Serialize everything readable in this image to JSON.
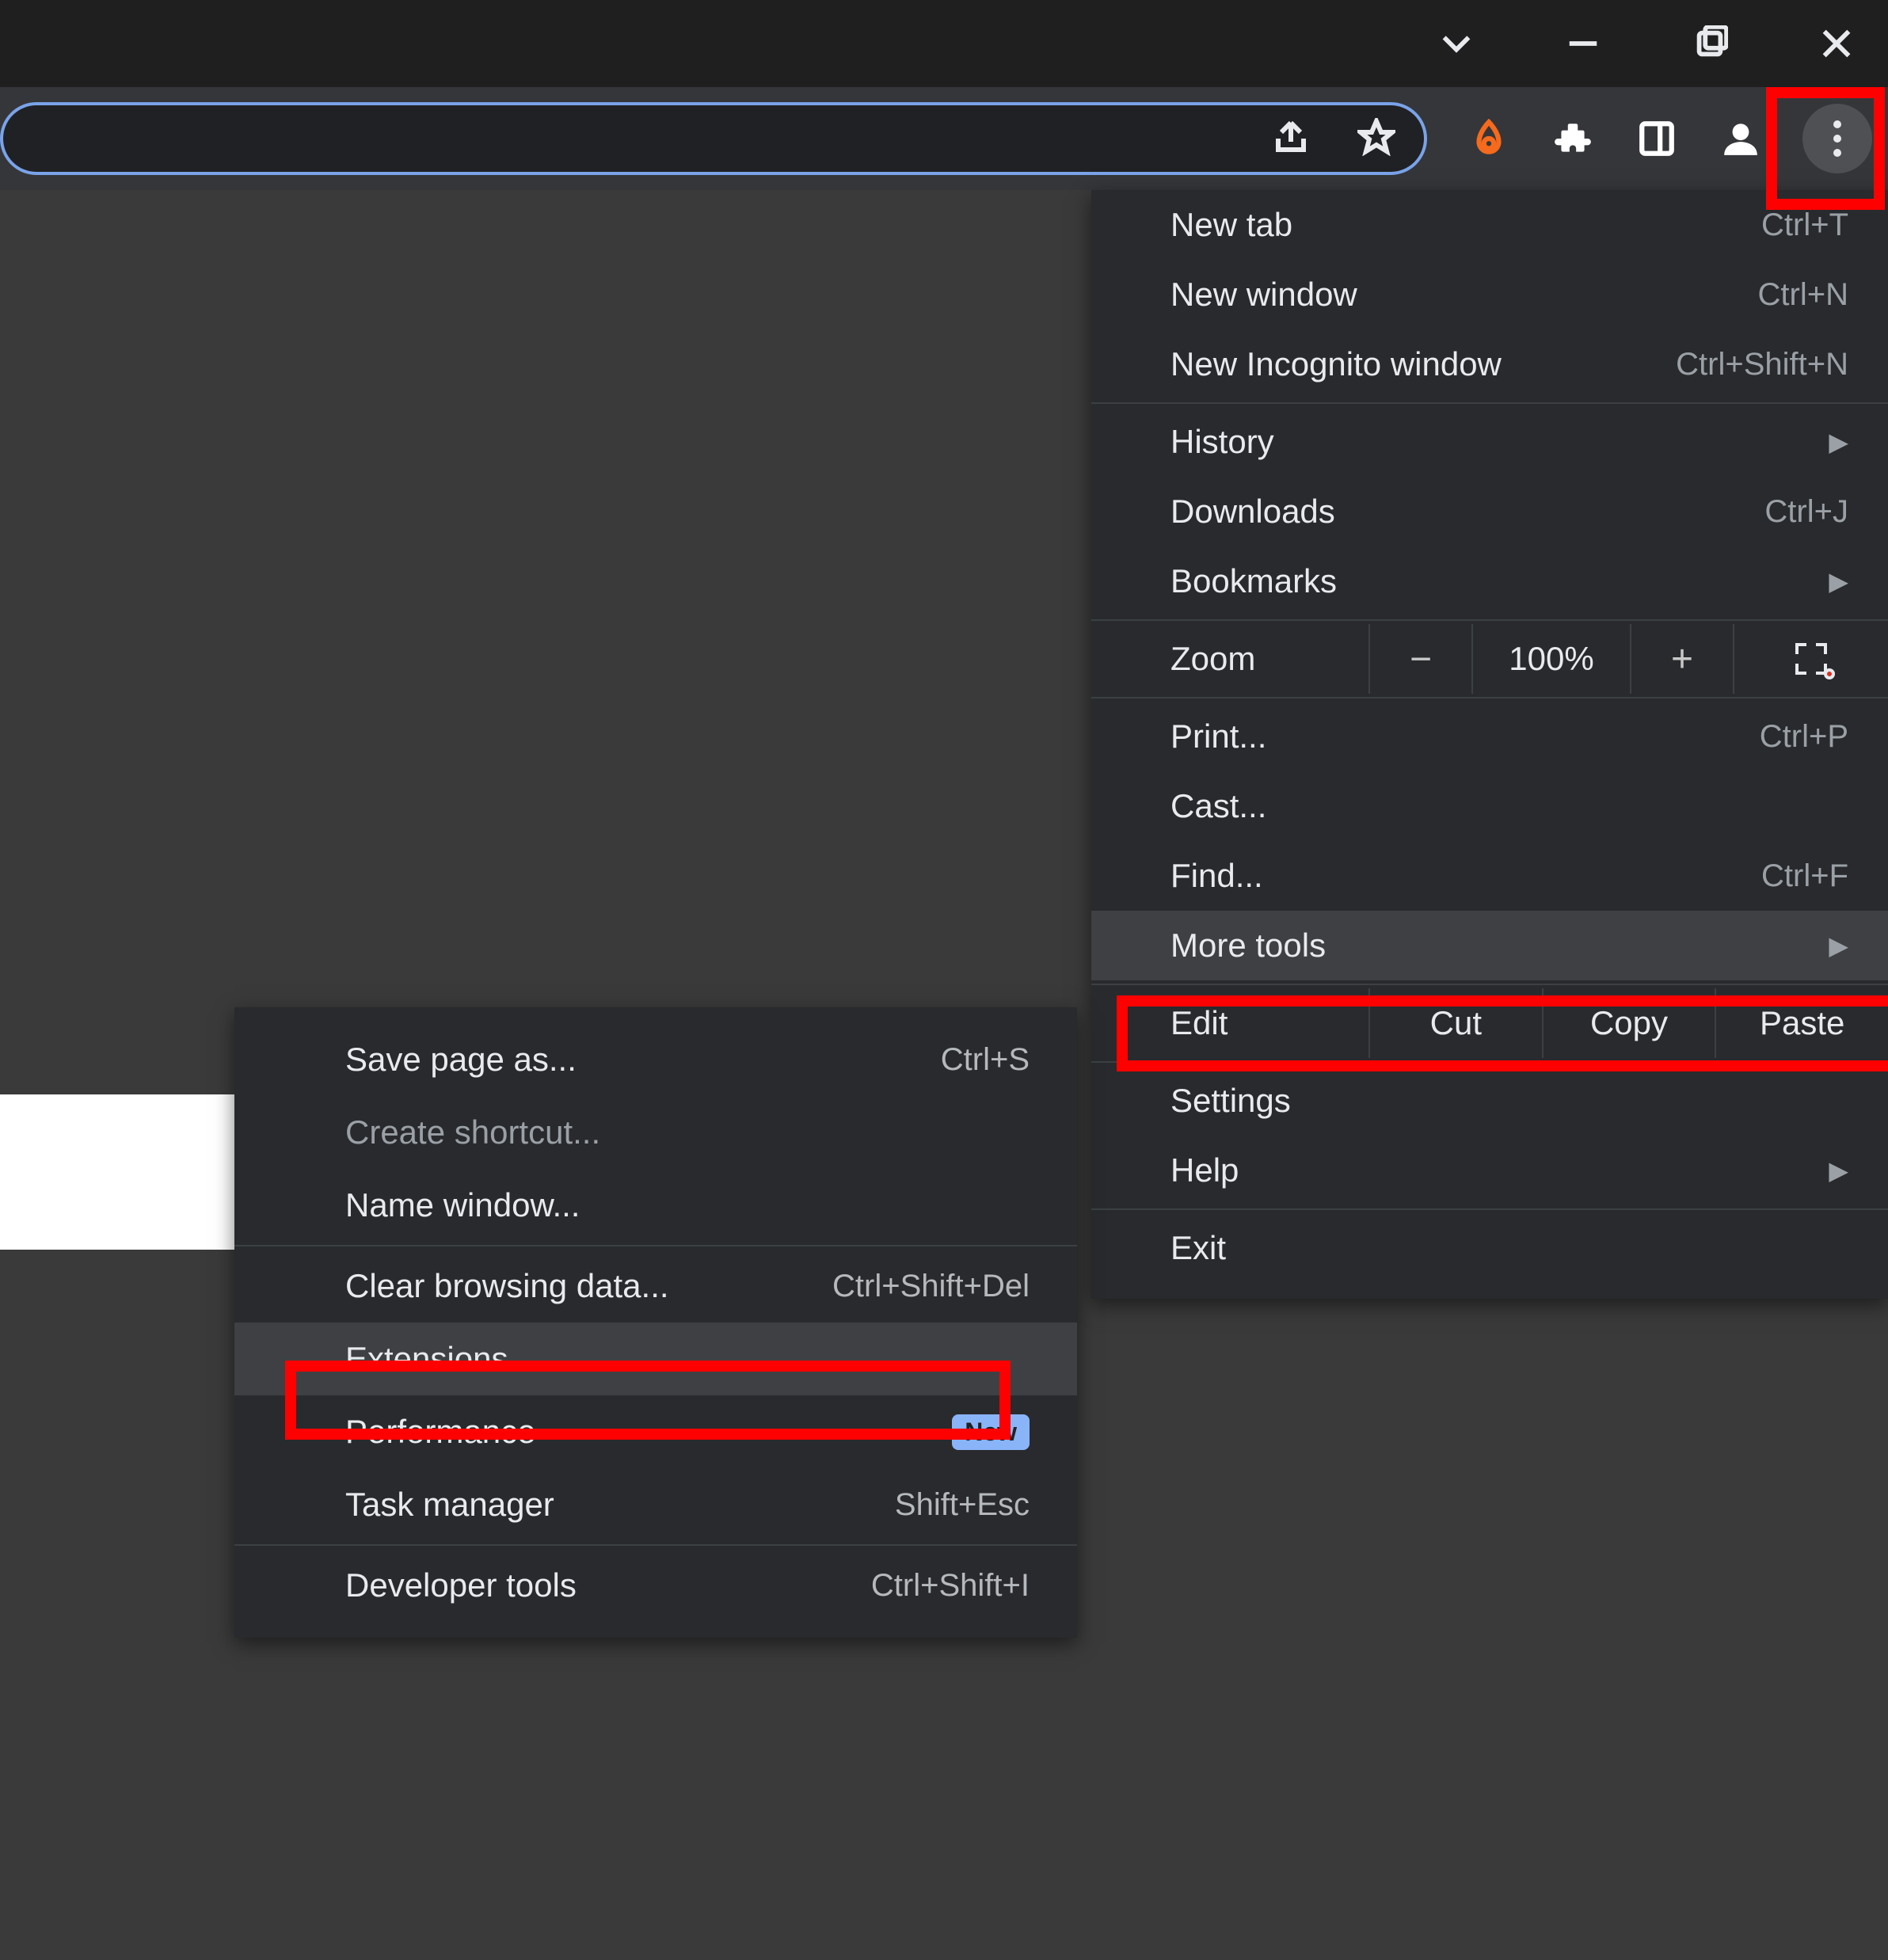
{
  "main_menu": {
    "new_tab": {
      "label": "New tab",
      "shortcut": "Ctrl+T"
    },
    "new_window": {
      "label": "New window",
      "shortcut": "Ctrl+N"
    },
    "new_incognito": {
      "label": "New Incognito window",
      "shortcut": "Ctrl+Shift+N"
    },
    "history": {
      "label": "History"
    },
    "downloads": {
      "label": "Downloads",
      "shortcut": "Ctrl+J"
    },
    "bookmarks": {
      "label": "Bookmarks"
    },
    "zoom": {
      "label": "Zoom",
      "minus": "−",
      "value": "100%",
      "plus": "+"
    },
    "print": {
      "label": "Print...",
      "shortcut": "Ctrl+P"
    },
    "cast": {
      "label": "Cast..."
    },
    "find": {
      "label": "Find...",
      "shortcut": "Ctrl+F"
    },
    "more_tools": {
      "label": "More tools"
    },
    "edit": {
      "label": "Edit",
      "cut": "Cut",
      "copy": "Copy",
      "paste": "Paste"
    },
    "settings": {
      "label": "Settings"
    },
    "help": {
      "label": "Help"
    },
    "exit": {
      "label": "Exit"
    }
  },
  "sub_menu": {
    "save_page": {
      "label": "Save page as...",
      "shortcut": "Ctrl+S"
    },
    "create_shortcut": {
      "label": "Create shortcut..."
    },
    "name_window": {
      "label": "Name window..."
    },
    "clear_data": {
      "label": "Clear browsing data...",
      "shortcut": "Ctrl+Shift+Del"
    },
    "extensions": {
      "label": "Extensions"
    },
    "performance": {
      "label": "Performance",
      "badge": "New"
    },
    "task_manager": {
      "label": "Task manager",
      "shortcut": "Shift+Esc"
    },
    "dev_tools": {
      "label": "Developer tools",
      "shortcut": "Ctrl+Shift+I"
    }
  }
}
